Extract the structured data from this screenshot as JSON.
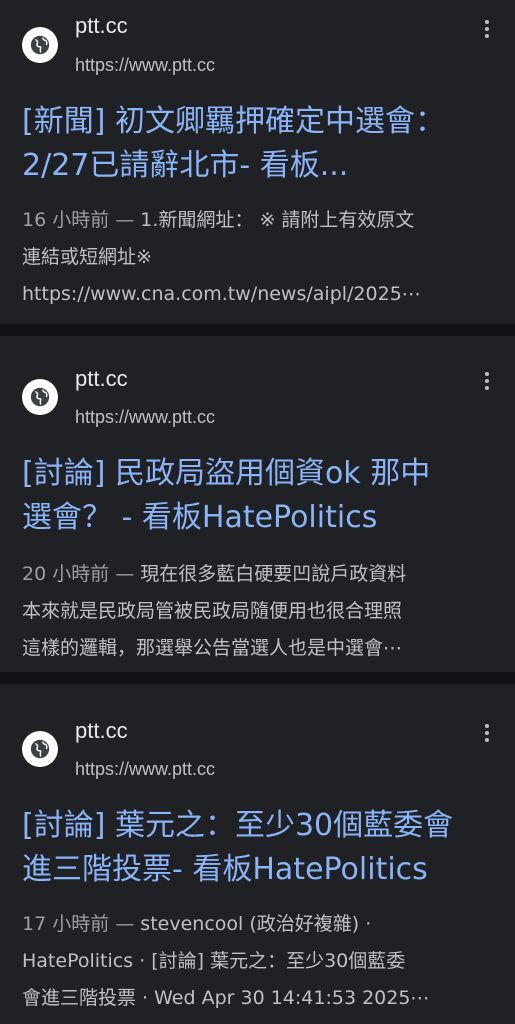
{
  "results": [
    {
      "site_name": "ptt.cc",
      "url": "https://www.ptt.cc",
      "title_line1": "[新聞] 初文卿羈押確定中選會：",
      "title_line2": "2/27已請辭北市- 看板...",
      "date": "16 小時前 —",
      "snippet_line1": " 1.新聞網址： ※ 請附上有效原文",
      "snippet_line2": "連結或短網址※",
      "snippet_line3": "https://www.cna.com.tw/news/aipl/2025⋯"
    },
    {
      "site_name": "ptt.cc",
      "url": "https://www.ptt.cc",
      "title_line1": "[討論] 民政局盜用個資ok 那中",
      "title_line2": "選會？ - 看板HatePolitics",
      "date": "20 小時前 —",
      "snippet_line1": " 現在很多藍白硬要凹說戶政資料",
      "snippet_line2": "本來就是民政局管被民政局隨便用也很合理照",
      "snippet_line3": "這樣的邏輯，那選舉公告當選人也是中選會⋯"
    },
    {
      "site_name": "ptt.cc",
      "url": "https://www.ptt.cc",
      "title_line1": "[討論] 葉元之：至少30個藍委會",
      "title_line2": "進三階投票- 看板HatePolitics",
      "date": "17 小時前 —",
      "snippet_line1": " stevencool (政治好複雜) ·",
      "snippet_line2": "HatePolitics · [討論] 葉元之：至少30個藍委",
      "snippet_line3": "會進三階投票 · Wed Apr 30 14:41:53 2025⋯"
    }
  ]
}
